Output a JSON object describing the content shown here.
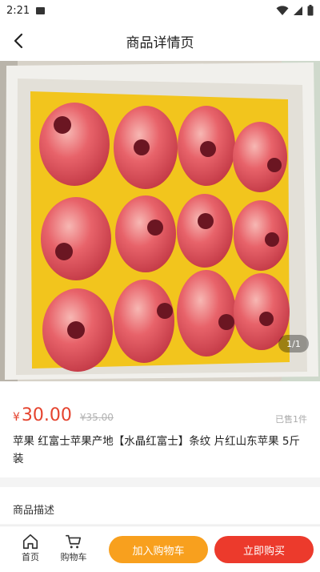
{
  "status_bar": {
    "time": "2:21"
  },
  "nav": {
    "title": "商品详情页"
  },
  "gallery": {
    "counter": "1/1"
  },
  "product": {
    "currency": "¥",
    "price": "30.00",
    "original_price": "¥35.00",
    "sold": "已售1件",
    "name": "苹果 红富士苹果产地【水晶红富士】条纹 片红山东苹果 5斤装"
  },
  "description": {
    "title": "商品描述"
  },
  "bottom_bar": {
    "home_label": "首页",
    "cart_label": "购物车",
    "add_to_cart_label": "加入购物车",
    "buy_now_label": "立即购买"
  },
  "colors": {
    "accent_red": "#ec3a2c",
    "accent_orange": "#f8a01e",
    "price_red": "#e5432e"
  }
}
